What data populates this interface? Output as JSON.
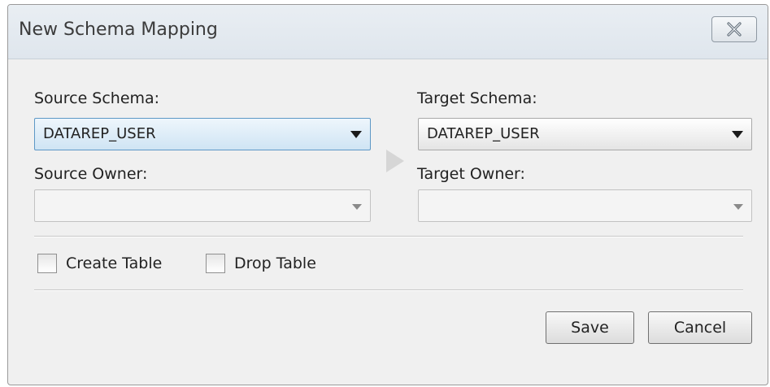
{
  "dialog": {
    "title": "New Schema Mapping",
    "close_icon": "close-icon"
  },
  "source": {
    "schema_label": "Source Schema:",
    "schema_value": "DATAREP_USER",
    "owner_label": "Source Owner:",
    "owner_value": ""
  },
  "target": {
    "schema_label": "Target Schema:",
    "schema_value": "DATAREP_USER",
    "owner_label": "Target Owner:",
    "owner_value": ""
  },
  "options": {
    "create_table_label": "Create Table",
    "create_table_checked": false,
    "drop_table_label": "Drop Table",
    "drop_table_checked": false
  },
  "buttons": {
    "save_label": "Save",
    "cancel_label": "Cancel"
  },
  "colors": {
    "focused_combo": "#cfe4f4",
    "dialog_bg": "#f0f0f0"
  }
}
